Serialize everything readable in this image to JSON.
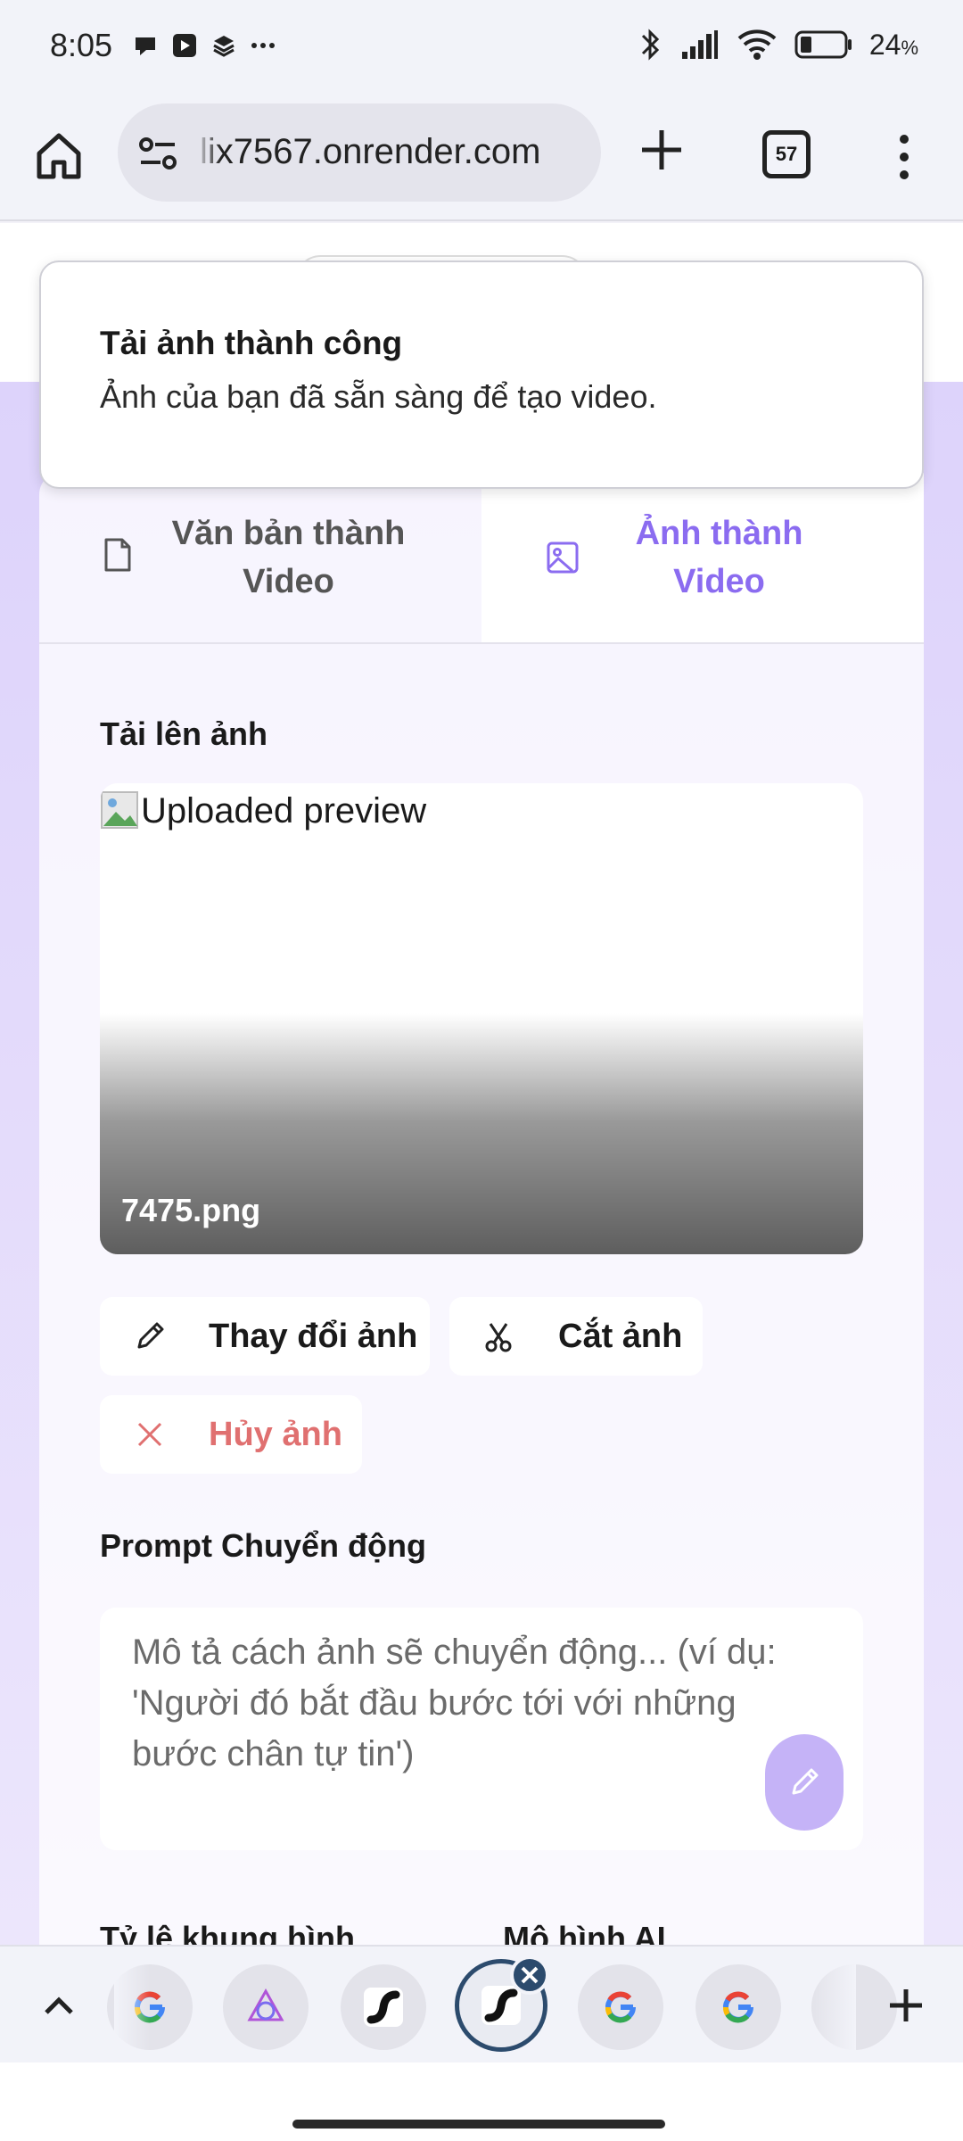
{
  "status_bar": {
    "time": "8:05",
    "battery": "24",
    "battery_unit": "%"
  },
  "browser": {
    "url": "lix7567.onrender.com",
    "tab_count": "57"
  },
  "toast": {
    "title": "Tải ảnh thành công",
    "message": "Ảnh của bạn đã sẵn sàng để tạo video."
  },
  "tabs": {
    "text_to_video": "Văn bản thành Video",
    "image_to_video": "Ảnh thành Video"
  },
  "upload": {
    "label": "Tải lên ảnh",
    "preview_alt": "Uploaded preview",
    "file_name": "7475.png"
  },
  "actions": {
    "change_image": "Thay đổi ảnh",
    "crop_image": "Cắt ảnh",
    "cancel_image": "Hủy ảnh"
  },
  "prompt": {
    "label": "Prompt Chuyển động",
    "placeholder": "Mô tả cách ảnh sẽ chuyển động... (ví dụ: 'Người đó bắt đầu bước tới với những bước chân tự tin')"
  },
  "settings": {
    "aspect_ratio_label": "Tỷ lệ khung hình",
    "model_label": "Mô hình AI"
  },
  "colors": {
    "accent": "#8b6cf0",
    "danger": "#e07070",
    "active_tab_ring": "#2c4b6d"
  }
}
